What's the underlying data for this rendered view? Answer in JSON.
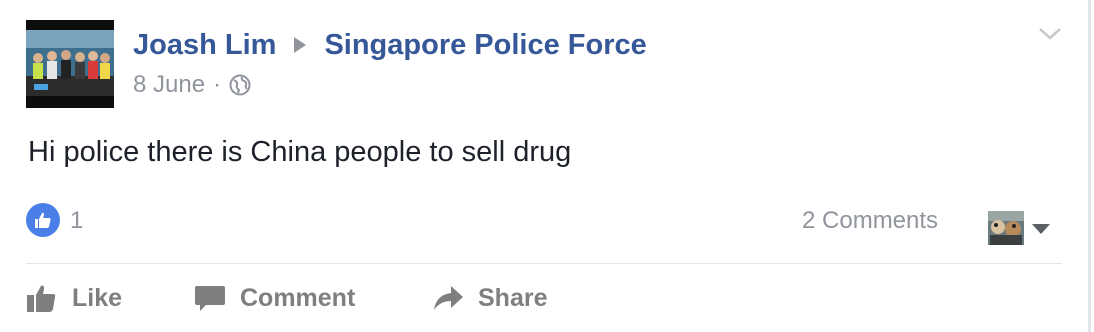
{
  "post": {
    "author": "Joash Lim",
    "target_page": "Singapore Police Force",
    "date": "8 June",
    "separator": "·",
    "privacy_icon": "globe-icon",
    "text": "Hi police there is China people to sell drug"
  },
  "stats": {
    "like_count": "1",
    "comments_label": "2 Comments"
  },
  "actions": {
    "like": "Like",
    "comment": "Comment",
    "share": "Share"
  },
  "colors": {
    "link": "#365899",
    "muted": "#90949c",
    "like_blue": "#4b7fe8",
    "text": "#1d2129"
  }
}
